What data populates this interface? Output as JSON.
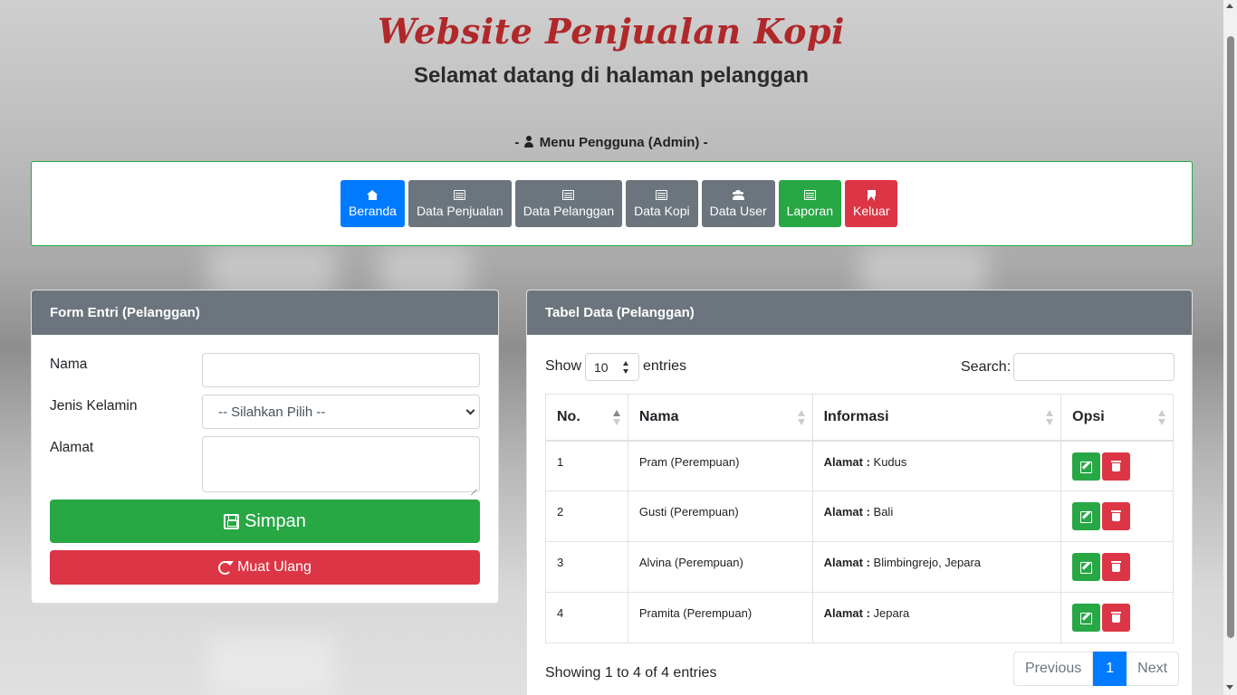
{
  "header": {
    "title": "Website Penjualan Kopi",
    "subtitle": "Selamat datang di halaman pelanggan",
    "menu_caption_prefix": "- ",
    "menu_caption": "Menu Pengguna (Admin) -"
  },
  "menu": {
    "items": [
      {
        "label": "Beranda",
        "icon": "home-icon",
        "color": "#007bff"
      },
      {
        "label": "Data Penjualan",
        "icon": "list-icon",
        "color": "#6c757d"
      },
      {
        "label": "Data Pelanggan",
        "icon": "list-icon",
        "color": "#6c757d"
      },
      {
        "label": "Data Kopi",
        "icon": "list-icon",
        "color": "#6c757d"
      },
      {
        "label": "Data User",
        "icon": "users-icon",
        "color": "#6c757d"
      },
      {
        "label": "Laporan",
        "icon": "list-icon",
        "color": "#28a745"
      },
      {
        "label": "Keluar",
        "icon": "bookmark-icon",
        "color": "#dc3545"
      }
    ]
  },
  "form": {
    "title": "Form Entri (Pelanggan)",
    "nama_label": "Nama",
    "nama_value": "",
    "jk_label": "Jenis Kelamin",
    "jk_selected": "-- Silahkan Pilih --",
    "alamat_label": "Alamat",
    "alamat_value": "",
    "save_label": "Simpan",
    "reload_label": "Muat Ulang"
  },
  "table": {
    "title": "Tabel Data (Pelanggan)",
    "show_label": "Show",
    "length_value": "10",
    "entries_label": "entries",
    "search_label": "Search:",
    "search_value": "",
    "columns": [
      "No.",
      "Nama",
      "Informasi",
      "Opsi"
    ],
    "alamat_key": "Alamat :",
    "rows": [
      {
        "no": "1",
        "nama": "Pram (Perempuan)",
        "alamat": "Kudus"
      },
      {
        "no": "2",
        "nama": "Gusti (Perempuan)",
        "alamat": "Bali"
      },
      {
        "no": "3",
        "nama": "Alvina (Perempuan)",
        "alamat": "Blimbingrejo, Jepara"
      },
      {
        "no": "4",
        "nama": "Pramita (Perempuan)",
        "alamat": "Jepara"
      }
    ],
    "info": "Showing 1 to 4 of 4 entries",
    "pagination": {
      "previous": "Previous",
      "current": "1",
      "next": "Next"
    }
  },
  "colors": {
    "title": "#b0282a",
    "primary": "#007bff",
    "secondary": "#6c757d",
    "success": "#28a745",
    "danger": "#dc3545"
  }
}
